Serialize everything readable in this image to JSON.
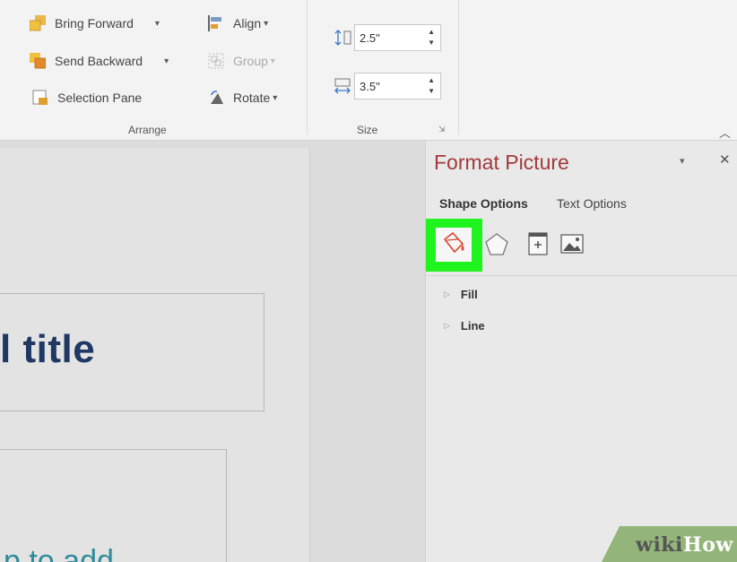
{
  "ribbon": {
    "arrange": {
      "bring_forward": "Bring Forward",
      "send_backward": "Send Backward",
      "selection_pane": "Selection Pane",
      "align": "Align",
      "group": "Group",
      "rotate": "Rotate",
      "label": "Arrange"
    },
    "size": {
      "height_value": "2.5\"",
      "width_value": "3.5\"",
      "label": "Size"
    }
  },
  "slide": {
    "title_fragment": "l title",
    "subtitle_fragment": "p to add"
  },
  "format_pane": {
    "title": "Format Picture",
    "tabs": [
      "Shape Options",
      "Text Options"
    ],
    "option_icons": [
      "fill-line-icon",
      "effects-icon",
      "size-properties-icon",
      "picture-icon"
    ],
    "sections": [
      "Fill",
      "Line"
    ],
    "highlight_color": "#1ff41f"
  },
  "watermark": {
    "wiki": "wiki",
    "how": "How"
  }
}
